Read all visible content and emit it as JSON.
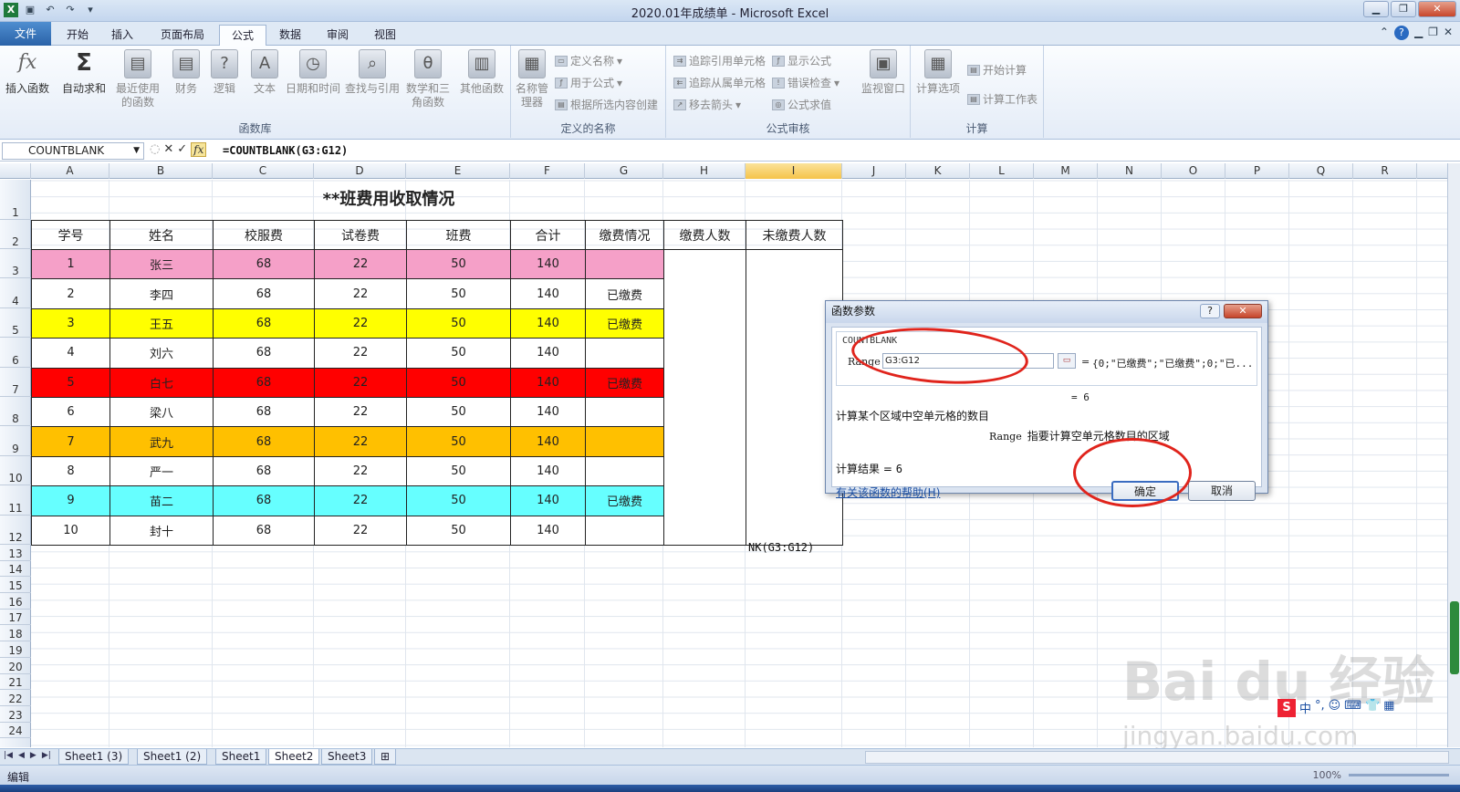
{
  "window": {
    "title": "2020.01年成绩单 - Microsoft Excel",
    "app_icon": "X"
  },
  "ribbon": {
    "tabs": [
      "文件",
      "开始",
      "插入",
      "页面布局",
      "公式",
      "数据",
      "审阅",
      "视图"
    ],
    "active_tab": "公式",
    "groups": {
      "function_library": {
        "label": "函数库",
        "buttons": [
          "插入函数",
          "自动求和",
          "最近使用的函数",
          "财务",
          "逻辑",
          "文本",
          "日期和时间",
          "查找与引用",
          "数学和三角函数",
          "其他函数"
        ]
      },
      "defined_names": {
        "label": "定义的名称",
        "big": "名称管理器",
        "small": [
          "定义名称",
          "用于公式",
          "根据所选内容创建"
        ]
      },
      "formula_auditing": {
        "label": "公式审核",
        "small": [
          "追踪引用单元格",
          "追踪从属单元格",
          "移去箭头",
          "显示公式",
          "错误检查",
          "公式求值"
        ],
        "big": "监视窗口"
      },
      "calculation": {
        "label": "计算",
        "big": "计算选项",
        "small": [
          "开始计算",
          "计算工作表"
        ]
      }
    }
  },
  "formula_bar": {
    "name_box": "COUNTBLANK",
    "cancel": "✕",
    "enter": "✓",
    "fx": "fx",
    "formula": "=COUNTBLANK(G3:G12)"
  },
  "columns": [
    "A",
    "B",
    "C",
    "D",
    "E",
    "F",
    "G",
    "H",
    "I",
    "J",
    "K",
    "L",
    "M",
    "N",
    "O",
    "P",
    "Q",
    "R"
  ],
  "selected_column": "I",
  "row_numbers": [
    "1",
    "2",
    "3",
    "4",
    "5",
    "6",
    "7",
    "8",
    "9",
    "10",
    "11",
    "12",
    "13",
    "14",
    "15",
    "16",
    "17",
    "18",
    "19",
    "20",
    "21",
    "22",
    "23",
    "24"
  ],
  "sheet": {
    "title": "**班费用收取情况",
    "headers": [
      "学号",
      "姓名",
      "校服费",
      "试卷费",
      "班费",
      "合计",
      "缴费情况",
      "缴费人数",
      "未缴费人数"
    ],
    "rows": [
      {
        "id": "1",
        "name": "张三",
        "a": "68",
        "b": "22",
        "c": "50",
        "total": "140",
        "status": "",
        "color": "#f5a0c8"
      },
      {
        "id": "2",
        "name": "李四",
        "a": "68",
        "b": "22",
        "c": "50",
        "total": "140",
        "status": "已缴费",
        "color": "#ffffff"
      },
      {
        "id": "3",
        "name": "王五",
        "a": "68",
        "b": "22",
        "c": "50",
        "total": "140",
        "status": "已缴费",
        "color": "#ffff00"
      },
      {
        "id": "4",
        "name": "刘六",
        "a": "68",
        "b": "22",
        "c": "50",
        "total": "140",
        "status": "",
        "color": "#ffffff"
      },
      {
        "id": "5",
        "name": "白七",
        "a": "68",
        "b": "22",
        "c": "50",
        "total": "140",
        "status": "已缴费",
        "color": "#ff0000"
      },
      {
        "id": "6",
        "name": "梁八",
        "a": "68",
        "b": "22",
        "c": "50",
        "total": "140",
        "status": "",
        "color": "#ffffff"
      },
      {
        "id": "7",
        "name": "武九",
        "a": "68",
        "b": "22",
        "c": "50",
        "total": "140",
        "status": "",
        "color": "#ffc000"
      },
      {
        "id": "8",
        "name": "严一",
        "a": "68",
        "b": "22",
        "c": "50",
        "total": "140",
        "status": "",
        "color": "#ffffff"
      },
      {
        "id": "9",
        "name": "苗二",
        "a": "68",
        "b": "22",
        "c": "50",
        "total": "140",
        "status": "已缴费",
        "color": "#66ffff"
      },
      {
        "id": "10",
        "name": "封十",
        "a": "68",
        "b": "22",
        "c": "50",
        "total": "140",
        "status": "",
        "color": "#ffffff"
      }
    ],
    "i12_text": "NK(G3:G12)"
  },
  "dialog": {
    "title": "函数参数",
    "function_name": "COUNTBLANK",
    "range_label": "Range",
    "range_value": "G3:G12",
    "range_eval": "{0;\"已缴费\";\"已缴费\";0;\"已...",
    "eq": "=",
    "result_eval": "= 6",
    "description": "计算某个区域中空单元格的数目",
    "param_name": "Range",
    "param_desc": "指要计算空单元格数目的区域",
    "result_label": "计算结果 =",
    "result_value": "6",
    "help_link": "有关该函数的帮助(H)",
    "ok": "确定",
    "cancel": "取消",
    "help_btn": "?",
    "close_btn": "✕"
  },
  "sheet_tabs": [
    "Sheet1 (3)",
    "Sheet1 (2)",
    "Sheet1",
    "Sheet2",
    "Sheet3"
  ],
  "active_sheet": "Sheet2",
  "status": {
    "mode": "编辑",
    "zoom": "100%"
  },
  "watermark": {
    "line1": "Bai du 经验",
    "line2": "jingyan.baidu.com"
  },
  "ime": [
    "中",
    "°,",
    "☺",
    "⌨",
    "👕",
    "▦"
  ]
}
